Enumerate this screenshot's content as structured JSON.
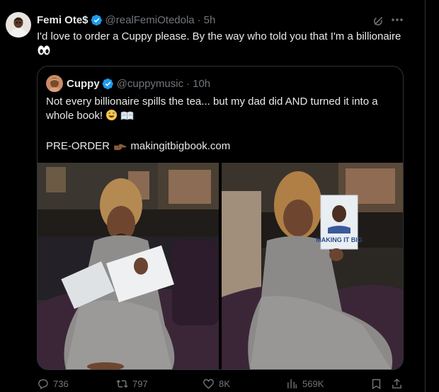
{
  "tweet": {
    "author_name": "Femi Ote$",
    "handle": "@realFemiOtedola",
    "separator": "·",
    "time": "5h",
    "text": "I'd love to order a Cuppy please. By the way who told you that I'm a billionaire",
    "emoji": "eyes"
  },
  "quoted_tweet": {
    "author_name": "Cuppy",
    "handle": "@cuppymusic",
    "separator": "·",
    "time": "10h",
    "line1": "Not every billionaire spills the tea... but my dad did AND turned it into a whole book!",
    "emojis_line1": [
      "grinning-sweat",
      "open-book"
    ],
    "line2_prefix": "PRE-ORDER",
    "line2_emoji": "pointing-hand",
    "link": "makingitbigbook.com",
    "book_cover_text": "MAKING IT BIG"
  },
  "actions": {
    "replies": "736",
    "reposts": "797",
    "likes": "8K",
    "views": "569K"
  },
  "icons": [
    "verified-badge-icon",
    "grok-icon",
    "more-icon",
    "reply-icon",
    "repost-icon",
    "like-icon",
    "views-icon",
    "bookmark-icon",
    "share-icon"
  ],
  "colors": {
    "background": "#000000",
    "text": "#e7e9ea",
    "secondary": "#71767b",
    "border": "#2f3336",
    "verified": "#1d9bf0"
  }
}
